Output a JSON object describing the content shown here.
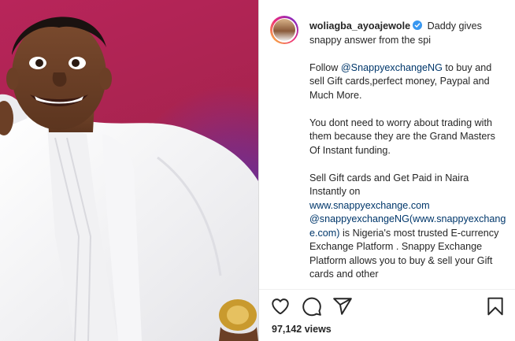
{
  "post": {
    "username": "woliagba_ayoajewole",
    "verified": true,
    "caption_lead": "Daddy gives snappy answer from the spi",
    "paragraph1": {
      "before": "Follow ",
      "mention": "@SnappyexchangeNG",
      "after": " to buy and sell Gift cards,perfect money, Paypal and Much More."
    },
    "paragraph2": "You dont need to worry about trading with them because they are the Grand Masters Of Instant funding.",
    "paragraph3": {
      "line1": "Sell Gift cards and Get Paid in Naira Instantly on",
      "link1": "www.snappyexchange.com",
      "mention2": "@snappyexchangeNG",
      "link2": "(www.snappyexchange.com)",
      "after": " is Nigeria's most trusted E-currency Exchange Platform . Snappy Exchange Platform allows you to buy & sell your Gift cards and other"
    },
    "views": "97,142 views"
  },
  "actions": {
    "like": "heart-icon",
    "comment": "comment-icon",
    "share": "share-icon",
    "save": "bookmark-icon"
  },
  "colors": {
    "link": "#00376b",
    "verified_badge": "#3897f0",
    "photo_background": "#a8234f"
  }
}
